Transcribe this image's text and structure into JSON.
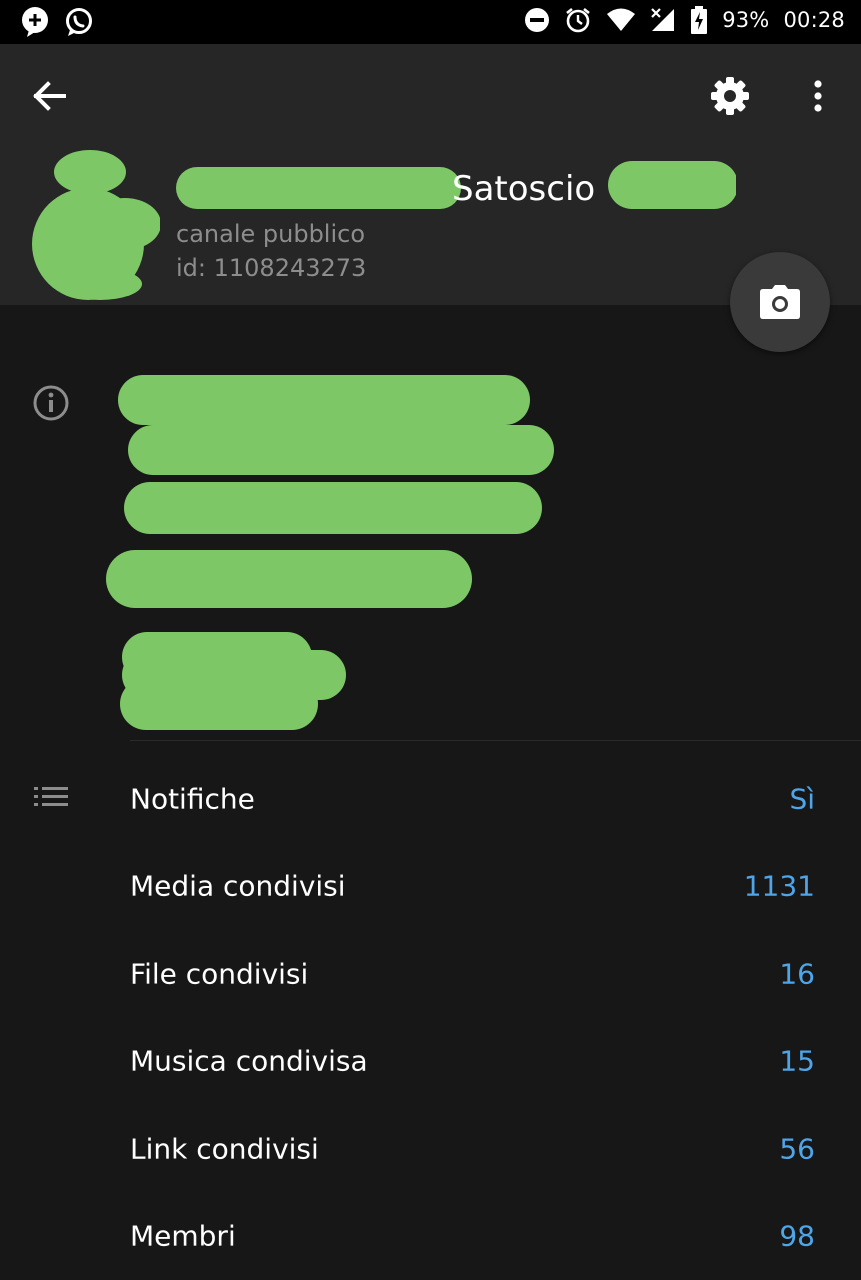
{
  "status_bar": {
    "battery": "93%",
    "time": "00:28",
    "left_icons": [
      "plus-bubble-icon",
      "whatsapp-icon"
    ],
    "right_icons": [
      "dnd-icon",
      "alarm-icon",
      "wifi-icon",
      "signal-icon",
      "battery-charging-icon"
    ]
  },
  "header": {
    "title_visible": "Satoscio",
    "subtitle": "canale pubblico",
    "id": "id: 1108243273",
    "redaction_color": "#7dc766"
  },
  "rows": [
    {
      "label": "Notifiche",
      "value": "Sì"
    },
    {
      "label": "Media condivisi",
      "value": "1131"
    },
    {
      "label": "File condivisi",
      "value": "16"
    },
    {
      "label": "Musica condivisa",
      "value": "15"
    },
    {
      "label": "Link condivisi",
      "value": "56"
    },
    {
      "label": "Membri",
      "value": "98"
    }
  ],
  "colors": {
    "accent": "#4ea5e8",
    "header_bg": "#262626",
    "body_bg": "#171717"
  }
}
